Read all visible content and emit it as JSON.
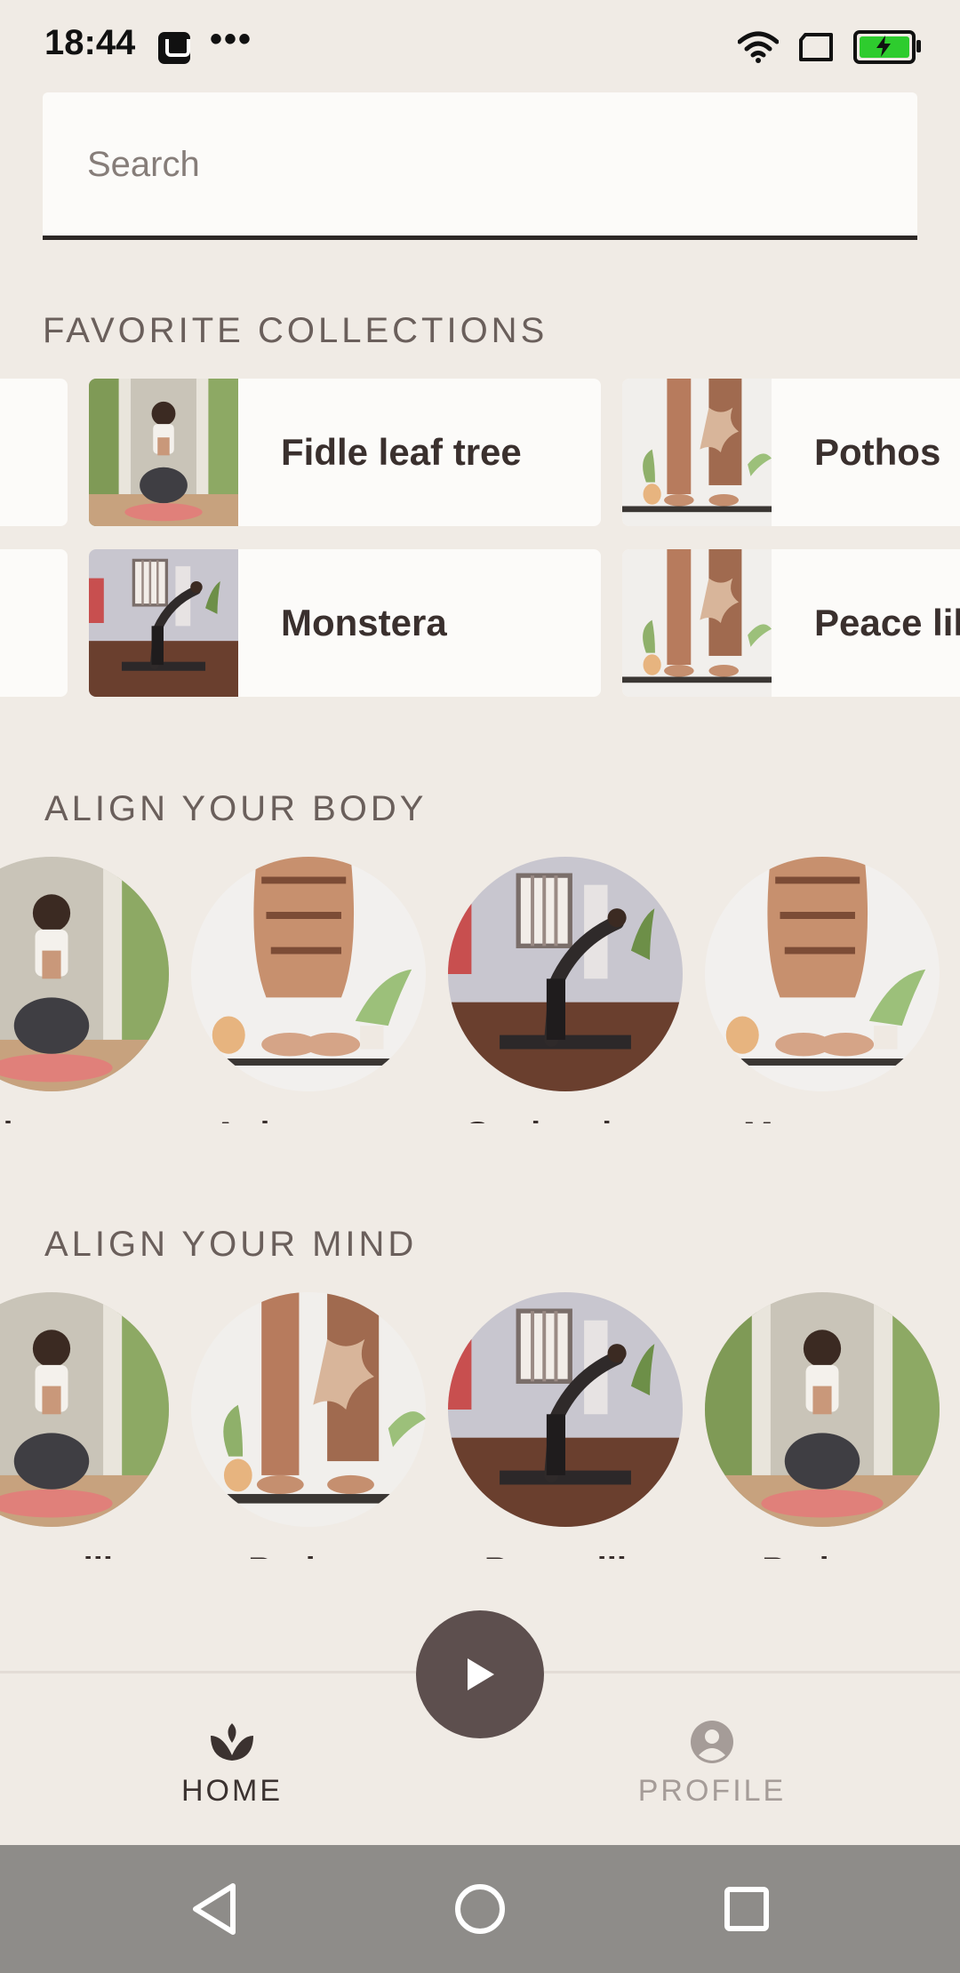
{
  "status_bar": {
    "time": "18:44",
    "notification_icons": [
      "app-icon",
      "more-dots-icon"
    ],
    "right_icons": [
      "wifi-icon",
      "sim-icon",
      "battery-charging-icon"
    ],
    "battery_color": "#2ecc2e"
  },
  "search": {
    "placeholder": "Search",
    "value": ""
  },
  "favorites": {
    "title": "FAVORITE COLLECTIONS",
    "items": [
      {
        "label": "Fidle leaf tree",
        "image": "yoga-meditation-photo"
      },
      {
        "label": "Pothos",
        "image": "yoga-feet-plant-photo"
      },
      {
        "label": "Monstera",
        "image": "yoga-stretch-room-photo"
      },
      {
        "label": "Peace lily",
        "image": "yoga-feet-plant-photo"
      }
    ]
  },
  "align_body": {
    "title": "ALIGN YOUR BODY",
    "items": [
      {
        "label": "Aglaonema",
        "image": "yoga-meditation-photo"
      },
      {
        "label": "Aglaonema",
        "image": "yoga-legs-plant-photo"
      },
      {
        "label": "Snake plant",
        "image": "yoga-stretch-room-photo"
      },
      {
        "label": "Monstera",
        "image": "yoga-legs-plant-photo"
      }
    ]
  },
  "align_mind": {
    "title": "ALIGN YOUR MIND",
    "items": [
      {
        "label": "Peace lily",
        "image": "yoga-meditation-photo"
      },
      {
        "label": "Pothos",
        "image": "yoga-feet-plant-photo"
      },
      {
        "label": "Peace lily",
        "image": "yoga-stretch-room-photo"
      },
      {
        "label": "Pothos",
        "image": "yoga-meditation-photo"
      }
    ]
  },
  "fab": {
    "icon": "play-icon"
  },
  "bottom_nav": {
    "home": {
      "label": "HOME",
      "icon": "spa-icon",
      "selected": true
    },
    "profile": {
      "label": "PROFILE",
      "icon": "account-circle-icon",
      "selected": false
    }
  },
  "system_nav": [
    "back-icon",
    "home-circle-icon",
    "recents-icon"
  ],
  "colors": {
    "background": "#f0ebe5",
    "surface": "#fcfbf9",
    "primary": "#5d4f4e",
    "text": "#3a302e",
    "inactive": "#a59c98",
    "system_nav": "#8e8c89"
  }
}
